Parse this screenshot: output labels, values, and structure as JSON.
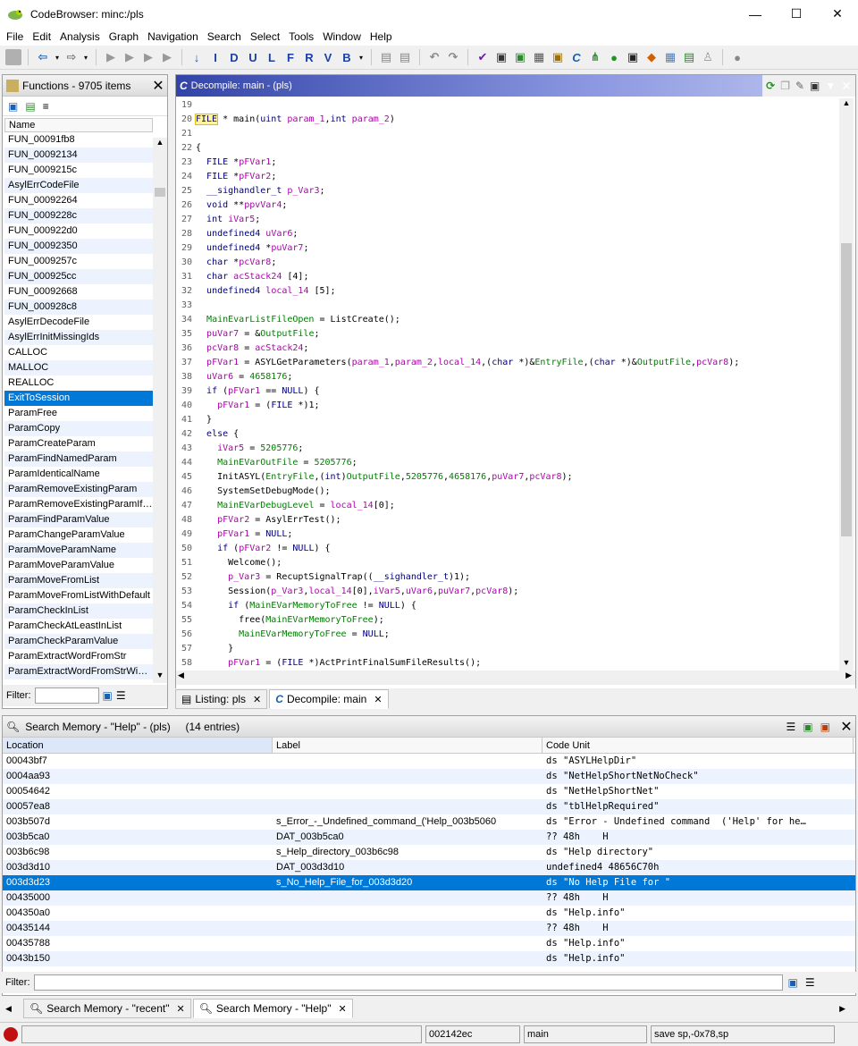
{
  "window": {
    "title": "CodeBrowser: minc:/pls",
    "minimize": "—",
    "maximize": "☐",
    "close": "✕"
  },
  "menu": [
    "File",
    "Edit",
    "Analysis",
    "Graph",
    "Navigation",
    "Search",
    "Select",
    "Tools",
    "Window",
    "Help"
  ],
  "toolbar_icons": [
    "save-icon",
    "back-icon",
    "forward-icon",
    "nav1-icon",
    "nav2-icon",
    "nav3-icon",
    "nav4-icon",
    "down-arrow-icon",
    "I-icon",
    "D-icon",
    "U-icon",
    "L-icon",
    "F-icon",
    "R-icon",
    "V-icon",
    "B-icon",
    "mem1-icon",
    "mem2-icon",
    "undo-icon",
    "redo-icon",
    "check-icon",
    "tool1-icon",
    "tool2-icon",
    "tool3-icon",
    "tool4-icon",
    "decompile-icon",
    "graph-icon",
    "run-icon",
    "terminal-icon",
    "diamond-icon",
    "table-icon",
    "export-icon",
    "person-icon",
    "sync-icon"
  ],
  "functions": {
    "title": "Functions - 9705 items",
    "column": "Name",
    "items": [
      "FUN_00091fb8",
      "FUN_00092134",
      "FUN_0009215c",
      "AsylErrCodeFile",
      "FUN_00092264",
      "FUN_0009228c",
      "FUN_000922d0",
      "FUN_00092350",
      "FUN_0009257c",
      "FUN_000925cc",
      "FUN_00092668",
      "FUN_000928c8",
      "AsylErrDecodeFile",
      "AsylErrInitMissingIds",
      "CALLOC",
      "MALLOC",
      "REALLOC",
      "ExitToSession",
      "ParamFree",
      "ParamCopy",
      "ParamCreateParam",
      "ParamFindNamedParam",
      "ParamIdenticalName",
      "ParamRemoveExistingParam",
      "ParamRemoveExistingParamIf…",
      "ParamFindParamValue",
      "ParamChangeParamValue",
      "ParamMoveParamName",
      "ParamMoveParamValue",
      "ParamMoveFromList",
      "ParamMoveFromListWithDefault",
      "ParamCheckInList",
      "ParamCheckAtLeastInList",
      "ParamCheckParamValue",
      "ParamExtractWordFromStr",
      "ParamExtractWordFromStrWi…"
    ],
    "selected": "ExitToSession",
    "filter_label": "Filter:",
    "filter_value": ""
  },
  "decompile": {
    "title": "Decompile: main -  (pls)",
    "lines": [
      {
        "n": "19",
        "t": ""
      },
      {
        "n": "20",
        "t": "FILE * main(uint param_1,int param_2)"
      },
      {
        "n": "21",
        "t": ""
      },
      {
        "n": "22",
        "t": "{"
      },
      {
        "n": "23",
        "t": "  FILE *pFVar1;"
      },
      {
        "n": "24",
        "t": "  FILE *pFVar2;"
      },
      {
        "n": "25",
        "t": "  __sighandler_t p_Var3;"
      },
      {
        "n": "26",
        "t": "  void **ppvVar4;"
      },
      {
        "n": "27",
        "t": "  int iVar5;"
      },
      {
        "n": "28",
        "t": "  undefined4 uVar6;"
      },
      {
        "n": "29",
        "t": "  undefined4 *puVar7;"
      },
      {
        "n": "30",
        "t": "  char *pcVar8;"
      },
      {
        "n": "31",
        "t": "  char acStack24 [4];"
      },
      {
        "n": "32",
        "t": "  undefined4 local_14 [5];"
      },
      {
        "n": "33",
        "t": ""
      },
      {
        "n": "34",
        "t": "  MainEvarListFileOpen = ListCreate();"
      },
      {
        "n": "35",
        "t": "  puVar7 = &OutputFile;"
      },
      {
        "n": "36",
        "t": "  pcVar8 = acStack24;"
      },
      {
        "n": "37",
        "t": "  pFVar1 = ASYLGetParameters(param_1,param_2,local_14,(char *)&EntryFile,(char *)&OutputFile,pcVar8);"
      },
      {
        "n": "38",
        "t": "  uVar6 = 4658176;"
      },
      {
        "n": "39",
        "t": "  if (pFVar1 == NULL) {"
      },
      {
        "n": "40",
        "t": "    pFVar1 = (FILE *)1;"
      },
      {
        "n": "41",
        "t": "  }"
      },
      {
        "n": "42",
        "t": "  else {"
      },
      {
        "n": "43",
        "t": "    iVar5 = 5205776;"
      },
      {
        "n": "44",
        "t": "    MainEVarOutFile = 5205776;"
      },
      {
        "n": "45",
        "t": "    InitASYL(EntryFile,(int)OutputFile,5205776,4658176,puVar7,pcVar8);"
      },
      {
        "n": "46",
        "t": "    SystemSetDebugMode();"
      },
      {
        "n": "47",
        "t": "    MainEVarDebugLevel = local_14[0];"
      },
      {
        "n": "48",
        "t": "    pFVar2 = AsylErrTest();"
      },
      {
        "n": "49",
        "t": "    pFVar1 = NULL;"
      },
      {
        "n": "50",
        "t": "    if (pFVar2 != NULL) {"
      },
      {
        "n": "51",
        "t": "      Welcome();"
      },
      {
        "n": "52",
        "t": "      p_Var3 = RecuptSignalTrap((__sighandler_t)1);"
      },
      {
        "n": "53",
        "t": "      Session(p_Var3,local_14[0],iVar5,uVar6,puVar7,pcVar8);"
      },
      {
        "n": "54",
        "t": "      if (MainEVarMemoryToFree != NULL) {"
      },
      {
        "n": "55",
        "t": "        free(MainEVarMemoryToFree);"
      },
      {
        "n": "56",
        "t": "        MainEVarMemoryToFree = NULL;"
      },
      {
        "n": "57",
        "t": "      }"
      },
      {
        "n": "58",
        "t": "      pFVar1 = (FILE *)ActPrintFinalSumFileResults();"
      }
    ]
  },
  "dec_tabs": [
    {
      "label": "Listing:  pls"
    },
    {
      "label": "Decompile: main"
    }
  ],
  "search": {
    "title": "Search Memory - \"Help\" - (pls)     (14 entries)",
    "columns": [
      "Location",
      "Label",
      "Code Unit"
    ],
    "rows": [
      {
        "loc": "00043bf7",
        "label": "",
        "cu": "ds \"ASYLHelpDir\""
      },
      {
        "loc": "0004aa93",
        "label": "",
        "cu": "ds \"NetHelpShortNetNoCheck\""
      },
      {
        "loc": "00054642",
        "label": "",
        "cu": "ds \"NetHelpShortNet\""
      },
      {
        "loc": "00057ea8",
        "label": "",
        "cu": "ds \"tblHelpRequired\""
      },
      {
        "loc": "003b507d",
        "label": "s_Error_-_Undefined_command_('Help_003b5060",
        "cu": "ds \"Error - Undefined command  ('Help' for he…"
      },
      {
        "loc": "003b5ca0",
        "label": "DAT_003b5ca0",
        "cu": "?? 48h    H"
      },
      {
        "loc": "003b6c98",
        "label": "s_Help_directory_003b6c98",
        "cu": "ds \"Help directory\""
      },
      {
        "loc": "003d3d10",
        "label": "DAT_003d3d10",
        "cu": "undefined4 48656C70h"
      },
      {
        "loc": "003d3d23",
        "label": "s_No_Help_File_for_003d3d20",
        "cu": "ds \"No Help File for \""
      },
      {
        "loc": "00435000",
        "label": "",
        "cu": "?? 48h    H"
      },
      {
        "loc": "004350a0",
        "label": "",
        "cu": "ds \"Help.info\""
      },
      {
        "loc": "00435144",
        "label": "",
        "cu": "?? 48h    H"
      },
      {
        "loc": "00435788",
        "label": "",
        "cu": "ds \"Help.info\""
      },
      {
        "loc": "0043b150",
        "label": "",
        "cu": "ds \"Help.info\""
      }
    ],
    "selected": "003d3d23",
    "filter_label": "Filter:"
  },
  "search_tabs": [
    {
      "label": "Search Memory - \"recent\""
    },
    {
      "label": "Search Memory - \"Help\""
    }
  ],
  "status": {
    "address": "002142ec",
    "function": "main",
    "instruction": "save sp,-0x78,sp"
  }
}
